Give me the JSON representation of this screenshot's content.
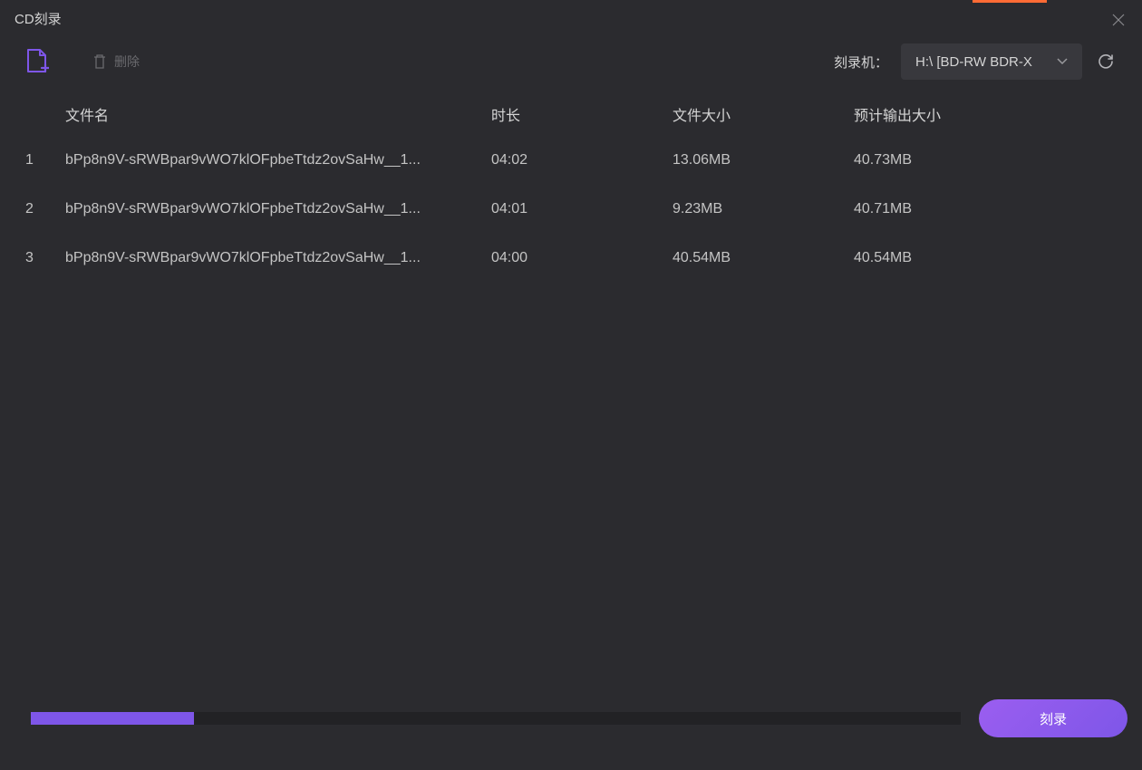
{
  "window": {
    "title": "CD刻录"
  },
  "toolbar": {
    "delete_label": "删除",
    "burner_label": "刻录机：",
    "burner_selected": "H:\\ [BD-RW   BDR-X"
  },
  "table": {
    "headers": {
      "name": "文件名",
      "duration": "时长",
      "size": "文件大小",
      "output": "预计输出大小"
    },
    "rows": [
      {
        "index": "1",
        "name": "bPp8n9V-sRWBpar9vWO7klOFpbeTtdz2ovSaHw__1...",
        "duration": "04:02",
        "size": "13.06MB",
        "output": "40.73MB"
      },
      {
        "index": "2",
        "name": "bPp8n9V-sRWBpar9vWO7klOFpbeTtdz2ovSaHw__1...",
        "duration": "04:01",
        "size": "9.23MB",
        "output": "40.71MB"
      },
      {
        "index": "3",
        "name": "bPp8n9V-sRWBpar9vWO7klOFpbeTtdz2ovSaHw__1...",
        "duration": "04:00",
        "size": "40.54MB",
        "output": "40.54MB"
      }
    ]
  },
  "footer": {
    "burn_label": "刻录",
    "progress_percent": 17.5
  },
  "colors": {
    "accent": "#7e56e8",
    "background": "#2b2b2f"
  }
}
